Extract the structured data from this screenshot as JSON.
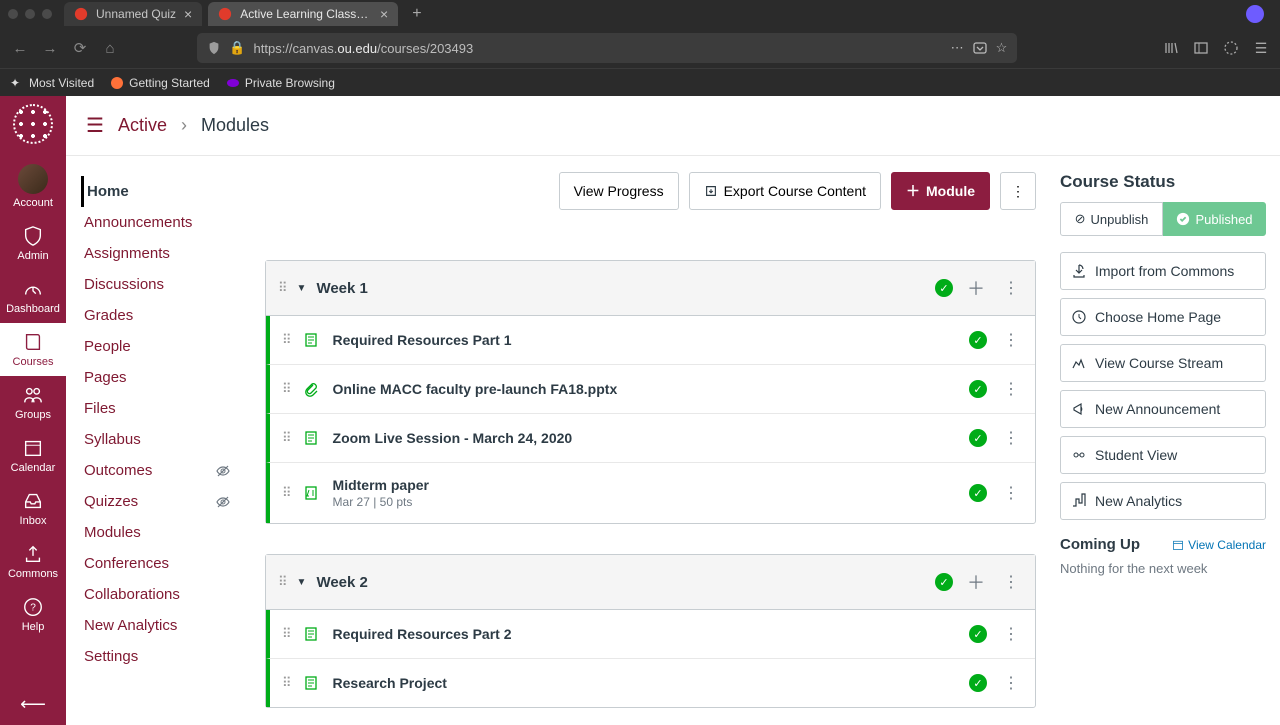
{
  "browser": {
    "tabs": [
      {
        "title": "Unnamed Quiz",
        "active": false
      },
      {
        "title": "Active Learning Classroom Cur",
        "active": true
      }
    ],
    "url": {
      "prefix": "https://canvas.",
      "domain": "ou.edu",
      "path": "/courses/203493"
    },
    "bookmarks": [
      {
        "label": "Most Visited"
      },
      {
        "label": "Getting Started"
      },
      {
        "label": "Private Browsing"
      }
    ]
  },
  "breadcrumb": {
    "course": "Active",
    "page": "Modules"
  },
  "global_nav": [
    {
      "label": "Account"
    },
    {
      "label": "Admin"
    },
    {
      "label": "Dashboard"
    },
    {
      "label": "Courses"
    },
    {
      "label": "Groups"
    },
    {
      "label": "Calendar"
    },
    {
      "label": "Inbox"
    },
    {
      "label": "Commons"
    },
    {
      "label": "Help"
    }
  ],
  "course_nav": [
    {
      "label": "Home",
      "active": true
    },
    {
      "label": "Announcements"
    },
    {
      "label": "Assignments"
    },
    {
      "label": "Discussions"
    },
    {
      "label": "Grades"
    },
    {
      "label": "People"
    },
    {
      "label": "Pages"
    },
    {
      "label": "Files"
    },
    {
      "label": "Syllabus"
    },
    {
      "label": "Outcomes",
      "hidden": true
    },
    {
      "label": "Quizzes",
      "hidden": true
    },
    {
      "label": "Modules"
    },
    {
      "label": "Conferences"
    },
    {
      "label": "Collaborations"
    },
    {
      "label": "New Analytics"
    },
    {
      "label": "Settings"
    }
  ],
  "actions": {
    "view_progress": "View Progress",
    "export": "Export Course Content",
    "add_module": "Module"
  },
  "modules": [
    {
      "title": "Week 1",
      "items": [
        {
          "type": "page",
          "title": "Required Resources Part 1"
        },
        {
          "type": "attachment",
          "title": "Online MACC faculty pre-launch FA18.pptx"
        },
        {
          "type": "page",
          "title": "Zoom Live Session - March 24, 2020"
        },
        {
          "type": "assignment",
          "title": "Midterm paper",
          "meta": "Mar 27  |  50 pts"
        }
      ]
    },
    {
      "title": "Week 2",
      "items": [
        {
          "type": "page",
          "title": "Required Resources Part 2"
        },
        {
          "type": "page",
          "title": "Research Project"
        }
      ]
    }
  ],
  "sidebar": {
    "status_title": "Course Status",
    "unpublish": "Unpublish",
    "published": "Published",
    "links": [
      "Import from Commons",
      "Choose Home Page",
      "View Course Stream",
      "New Announcement",
      "Student View",
      "New Analytics"
    ],
    "coming_up": "Coming Up",
    "view_calendar": "View Calendar",
    "nothing": "Nothing for the next week"
  }
}
